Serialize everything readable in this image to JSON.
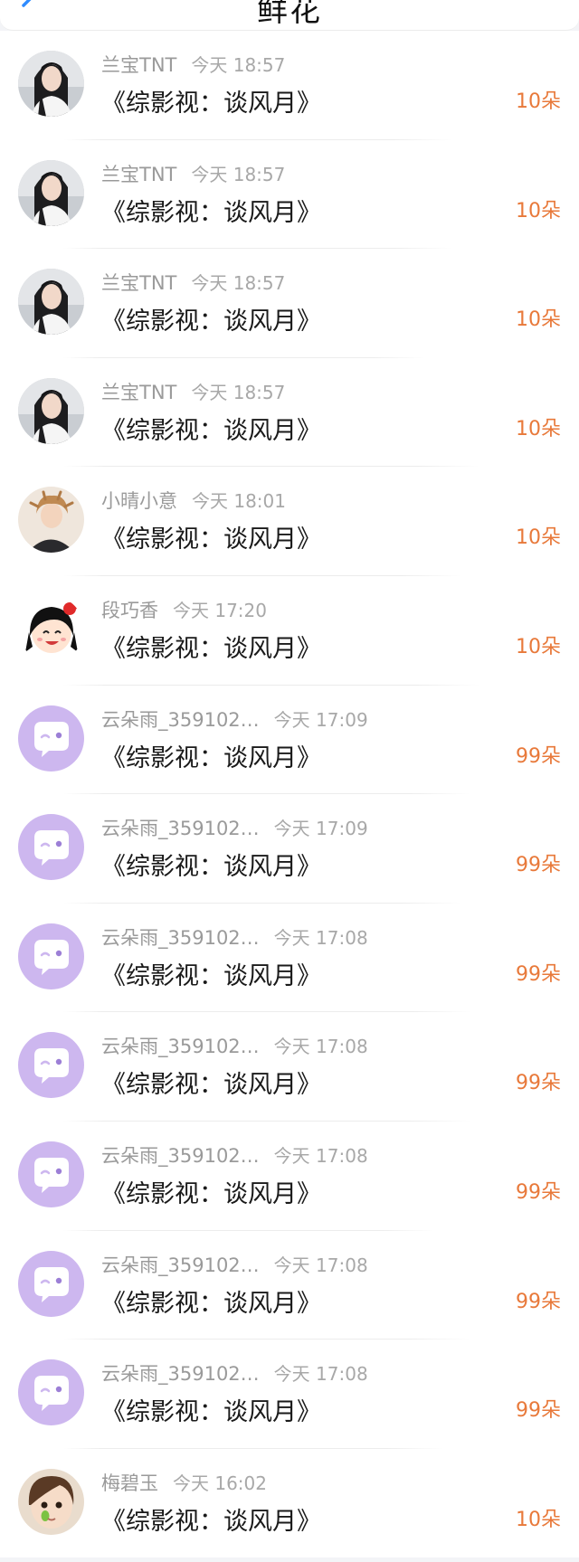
{
  "header": {
    "title": "鲜花",
    "back_icon": "chevron-left-icon",
    "accent": "#2f8cff"
  },
  "colors": {
    "amount": "#e8793a",
    "name": "#9a9a9a",
    "book": "#1a1a1a",
    "default_avatar_bg": "#cdb7ef"
  },
  "records": [
    {
      "name": "兰宝TNT",
      "time": "今天 18:57",
      "book": "《综影视：谈风月》",
      "amount": "10朵",
      "avatar": "photo-woman-icon"
    },
    {
      "name": "兰宝TNT",
      "time": "今天 18:57",
      "book": "《综影视：谈风月》",
      "amount": "10朵",
      "avatar": "photo-woman-icon"
    },
    {
      "name": "兰宝TNT",
      "time": "今天 18:57",
      "book": "《综影视：谈风月》",
      "amount": "10朵",
      "avatar": "photo-woman-icon"
    },
    {
      "name": "兰宝TNT",
      "time": "今天 18:57",
      "book": "《综影视：谈风月》",
      "amount": "10朵",
      "avatar": "photo-woman-icon"
    },
    {
      "name": "小晴小意",
      "time": "今天 18:01",
      "book": "《综影视：谈风月》",
      "amount": "10朵",
      "avatar": "photo-boy-icon"
    },
    {
      "name": "段巧香",
      "time": "今天 17:20",
      "book": "《综影视：谈风月》",
      "amount": "10朵",
      "avatar": "cartoon-girl-icon"
    },
    {
      "name": "云朵雨_359102…",
      "time": "今天 17:09",
      "book": "《综影视：谈风月》",
      "amount": "99朵",
      "avatar": "default-chat-bubble-icon"
    },
    {
      "name": "云朵雨_359102…",
      "time": "今天 17:09",
      "book": "《综影视：谈风月》",
      "amount": "99朵",
      "avatar": "default-chat-bubble-icon"
    },
    {
      "name": "云朵雨_359102…",
      "time": "今天 17:08",
      "book": "《综影视：谈风月》",
      "amount": "99朵",
      "avatar": "default-chat-bubble-icon"
    },
    {
      "name": "云朵雨_359102…",
      "time": "今天 17:08",
      "book": "《综影视：谈风月》",
      "amount": "99朵",
      "avatar": "default-chat-bubble-icon"
    },
    {
      "name": "云朵雨_359102…",
      "time": "今天 17:08",
      "book": "《综影视：谈风月》",
      "amount": "99朵",
      "avatar": "default-chat-bubble-icon"
    },
    {
      "name": "云朵雨_359102…",
      "time": "今天 17:08",
      "book": "《综影视：谈风月》",
      "amount": "99朵",
      "avatar": "default-chat-bubble-icon"
    },
    {
      "name": "云朵雨_359102…",
      "time": "今天 17:08",
      "book": "《综影视：谈风月》",
      "amount": "99朵",
      "avatar": "default-chat-bubble-icon"
    },
    {
      "name": "梅碧玉",
      "time": "今天 16:02",
      "book": "《综影视：谈风月》",
      "amount": "10朵",
      "avatar": "photo-child-icon"
    }
  ]
}
